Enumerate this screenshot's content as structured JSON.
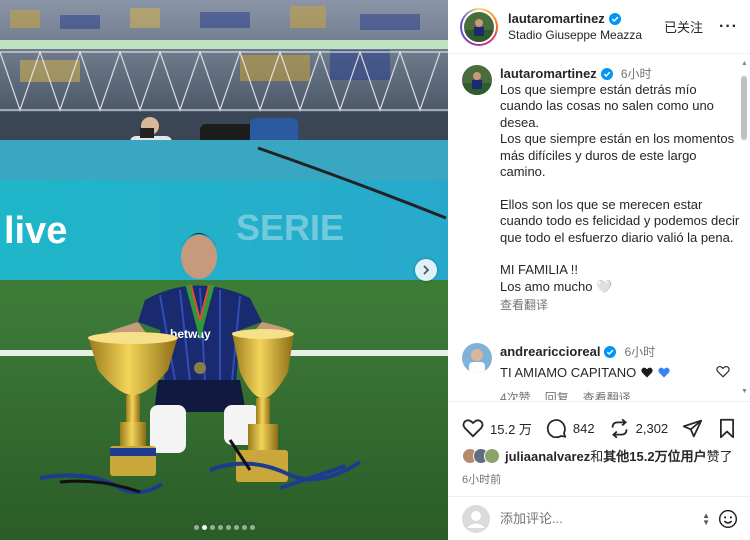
{
  "colors": {
    "verified": "#0095f6",
    "heart_blue": "#3b82f6",
    "text_secondary": "#737373"
  },
  "photo": {
    "banner_left_text": "live",
    "banner_right_text": "SERIE",
    "jersey_text": "betway",
    "carousel_dots": 8,
    "active_dot": 1
  },
  "header": {
    "username": "lautaromartinez",
    "location": "Stadio Giuseppe Meazza",
    "follow_status": "已关注",
    "more_icon": "more-dots-icon"
  },
  "caption": {
    "username": "lautaromartinez",
    "time": "6小时",
    "text": "Los que siempre están detrás mío cuando las cosas no salen como uno desea.\nLos que siempre están en los momentos  más difíciles y duros de este largo camino.\n\nEllos son los  que se merecen estar cuando todo es felicidad y podemos decir que todo el esfuerzo diario valió la pena.\n\nMI FAMILIA !!\nLos amo mucho 🤍",
    "translate": "查看翻译"
  },
  "comment": {
    "username": "andreariccioreal",
    "time": "6小时",
    "text": "TI AMIAMO CAPITANO",
    "likes": "4次赞",
    "reply": "回复",
    "translate": "查看翻译"
  },
  "actions": {
    "likes_count": "15.2 万",
    "comments_count": "842",
    "reposts_count": "2,302"
  },
  "liked_by": {
    "user": "juliaanalvarez",
    "rest": "和",
    "others": "其他15.2万位用户",
    "suffix": "赞了"
  },
  "posted_ago": "6小时前",
  "add_comment": {
    "placeholder": "添加评论..."
  }
}
